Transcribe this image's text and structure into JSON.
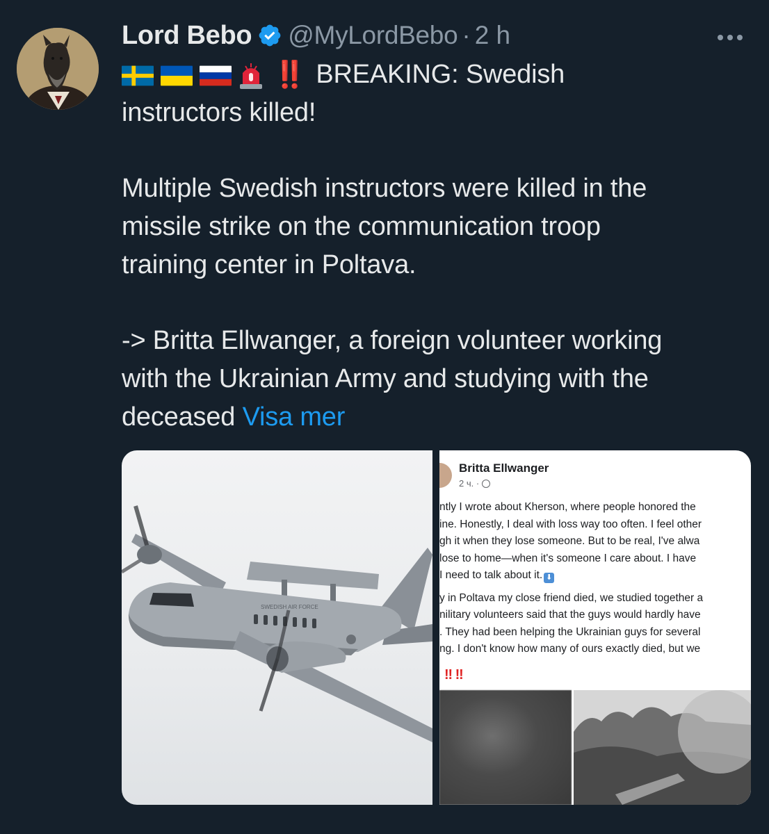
{
  "author": {
    "display_name": "Lord Bebo",
    "handle": "@MyLordBebo",
    "separator": "·",
    "timestamp": "2 h",
    "verified": true,
    "avatar_icon": "dog-in-suit-avatar"
  },
  "tweet": {
    "emoji_prefix": [
      "sweden-flag",
      "ukraine-flag",
      "russia-flag",
      "siren-emoji",
      "double-exclamation-emoji"
    ],
    "double_exclamation": "‼️",
    "line_1": "BREAKING: Swedish",
    "line_2": "instructors killed!",
    "para_2_line_1": "Multiple Swedish instructors were killed in the",
    "para_2_line_2": "missile strike on the communication troop",
    "para_2_line_3": "training center in Poltava.",
    "para_3_line_1": "-> Britta Ellwanger, a foreign volunteer working",
    "para_3_line_2": "with the Ukrainian Army and studying with the",
    "para_3_line_3": "deceased",
    "show_more": "Visa mer"
  },
  "media": {
    "left_image": "swedish-air-force-surveillance-aircraft-photo",
    "aircraft_marking": "SWEDISH AIR FORCE",
    "right_image": {
      "post_author": "Britta Ellwanger",
      "post_time": "2 ч. ·",
      "lines": [
        "ntly I wrote about Kherson, where people honored the",
        "ine. Honestly, I deal with loss way too often. I feel other",
        "gh it when they lose someone. But to be real, I've alwa",
        "lose to home—when it's someone I care about. I have",
        "I need to talk about it."
      ],
      "lines_2": [
        "y in Poltava my close friend died, we studied together a",
        "nilitary volunteers said that the guys would hardly have",
        ". They had been helping the Ukrainian guys for several",
        "ng. I don't know how many of ours exactly died, but we"
      ],
      "bangs": "‼ ‼"
    }
  },
  "colors": {
    "background": "#15202b",
    "text": "#e7e9ea",
    "secondary_text": "#8b98a5",
    "link": "#1d9bf0",
    "verified_badge": "#1d9bf0"
  }
}
